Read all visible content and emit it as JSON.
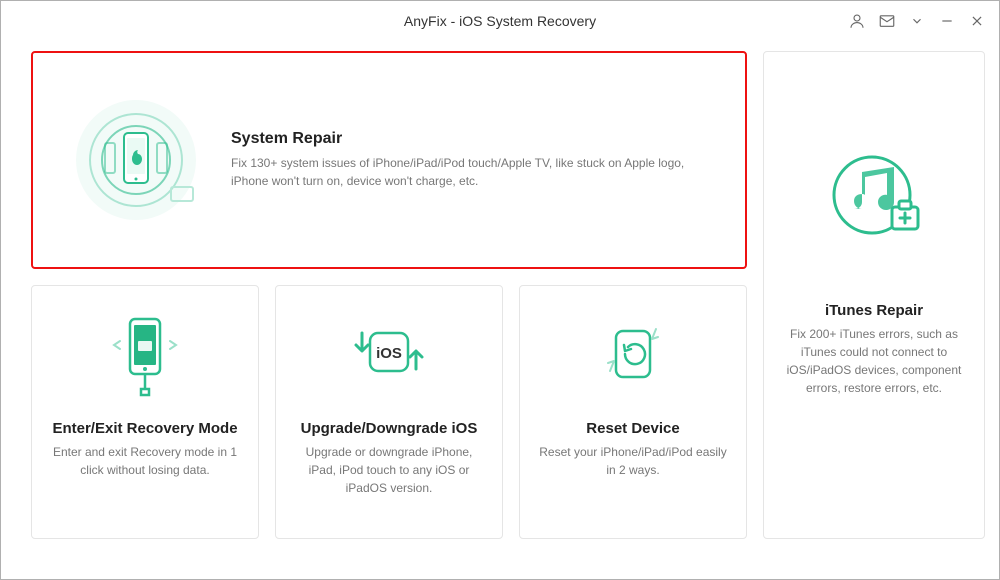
{
  "window": {
    "title": "AnyFix - iOS System Recovery"
  },
  "cards": {
    "system_repair": {
      "title": "System Repair",
      "desc": "Fix 130+ system issues of iPhone/iPad/iPod touch/Apple TV, like stuck on Apple logo, iPhone won't turn on, device won't charge, etc."
    },
    "itunes_repair": {
      "title": "iTunes Repair",
      "desc": "Fix 200+ iTunes errors, such as iTunes could not connect to iOS/iPadOS devices, component errors, restore errors, etc."
    },
    "recovery_mode": {
      "title": "Enter/Exit Recovery Mode",
      "desc": "Enter and exit Recovery mode in 1 click without losing data."
    },
    "upgrade_downgrade": {
      "title": "Upgrade/Downgrade iOS",
      "desc": "Upgrade or downgrade iPhone, iPad, iPod touch to any iOS or iPadOS version."
    },
    "reset_device": {
      "title": "Reset Device",
      "desc": "Reset your iPhone/iPad/iPod easily in 2 ways."
    }
  }
}
